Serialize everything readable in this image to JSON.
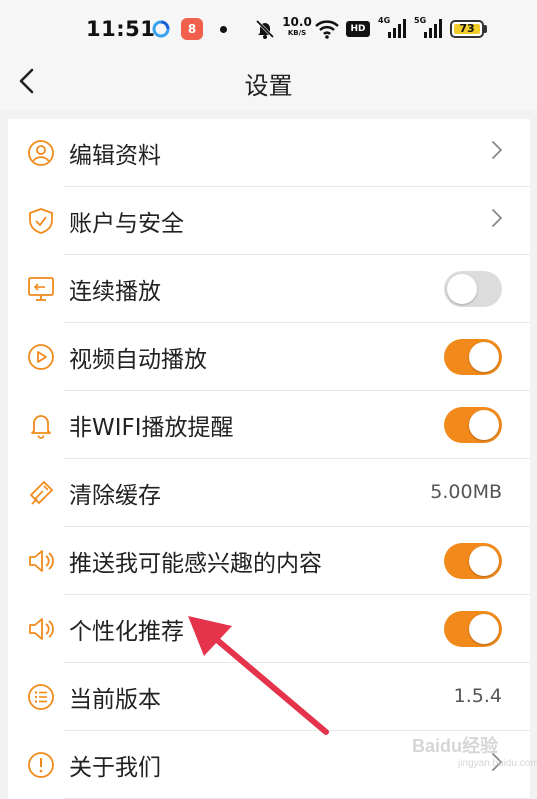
{
  "status_bar": {
    "time": "11:51",
    "app_badge": "8",
    "speed_value": "10.0",
    "speed_unit": "KB/S",
    "hd_label": "HD",
    "sim1_net": "4G",
    "sim2_net": "5G",
    "battery": "73",
    "battery_color": "#f2cc2d"
  },
  "header": {
    "title": "设置"
  },
  "accent_color": "#f18a1b",
  "items": [
    {
      "label": "编辑资料",
      "icon": "user-icon",
      "control": "chevron"
    },
    {
      "label": "账户与安全",
      "icon": "shield-icon",
      "control": "chevron"
    },
    {
      "label": "连续播放",
      "icon": "monitor-icon",
      "control": "toggle",
      "on": false
    },
    {
      "label": "视频自动播放",
      "icon": "play-circle-icon",
      "control": "toggle",
      "on": true
    },
    {
      "label": "非WIFI播放提醒",
      "icon": "bell-icon",
      "control": "toggle",
      "on": true
    },
    {
      "label": "清除缓存",
      "icon": "broom-icon",
      "control": "value",
      "value": "5.00MB"
    },
    {
      "label": "推送我可能感兴趣的内容",
      "icon": "speaker-icon",
      "control": "toggle",
      "on": true
    },
    {
      "label": "个性化推荐",
      "icon": "speaker-icon",
      "control": "toggle",
      "on": true
    },
    {
      "label": "当前版本",
      "icon": "list-icon",
      "control": "value",
      "value": "1.5.4"
    },
    {
      "label": "关于我们",
      "icon": "info-icon",
      "control": "chevron"
    }
  ],
  "watermark": {
    "brand": "Baidu经验",
    "url": "jingyan.baidu.com"
  }
}
